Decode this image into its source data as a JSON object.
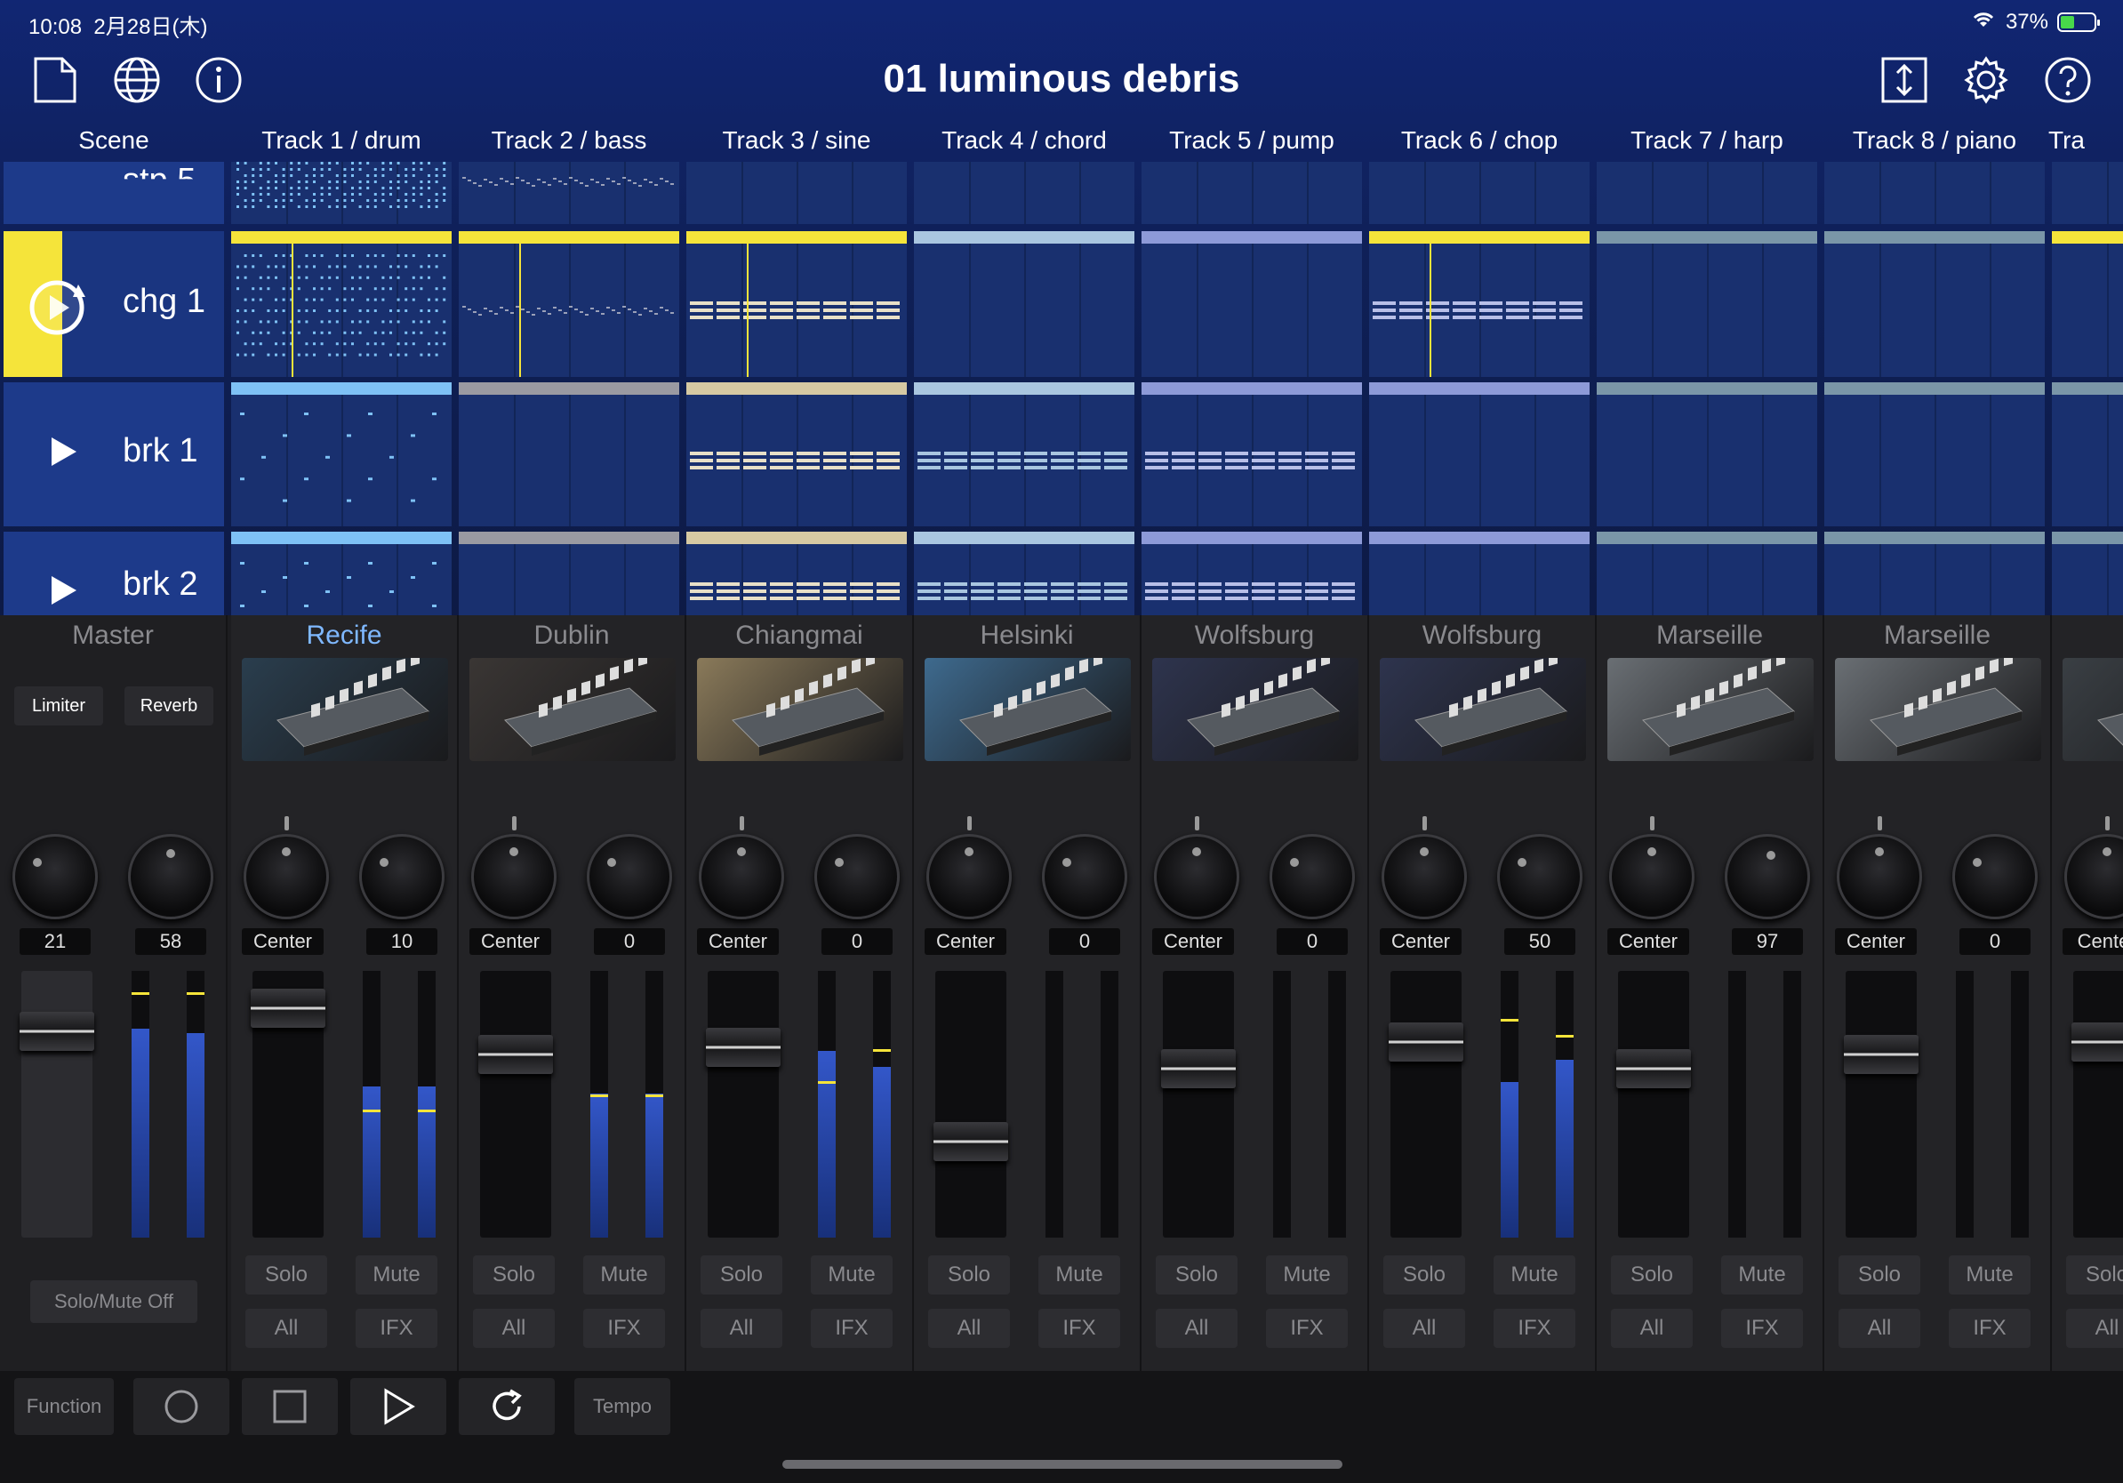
{
  "status": {
    "time": "10:08",
    "date": "2月28日(木)",
    "battery": "37%"
  },
  "header": {
    "title": "01 luminous debris"
  },
  "icons": {
    "new_doc": "document-icon",
    "web": "globe-icon",
    "info": "info-icon",
    "resize": "resize-vertical-icon",
    "settings": "gear-icon",
    "help": "help-icon"
  },
  "grid": {
    "scene_header": "Scene",
    "tracks": [
      "Track 1 / drum",
      "Track 2 / bass",
      "Track 3 / sine",
      "Track 4 / chord",
      "Track 5 / pump",
      "Track 6 / chop",
      "Track 7 / harp",
      "Track 8 / piano",
      "Tra"
    ],
    "scenes": [
      {
        "label": "stp 5",
        "partial": true
      },
      {
        "label": "chg 1",
        "playing": true
      },
      {
        "label": "brk 1"
      },
      {
        "label": "brk 2",
        "partial": true
      }
    ]
  },
  "mixer": {
    "master": {
      "name": "Master",
      "limiter": "Limiter",
      "reverb": "Reverb",
      "knob_left": "21",
      "knob_right": "58",
      "solo_mute_off": "Solo/Mute Off"
    },
    "strips": [
      {
        "name": "Recife",
        "pan": "Center",
        "send": "10",
        "active": true
      },
      {
        "name": "Dublin",
        "pan": "Center",
        "send": "0"
      },
      {
        "name": "Chiangmai",
        "pan": "Center",
        "send": "0"
      },
      {
        "name": "Helsinki",
        "pan": "Center",
        "send": "0"
      },
      {
        "name": "Wolfsburg",
        "pan": "Center",
        "send": "0"
      },
      {
        "name": "Wolfsburg",
        "pan": "Center",
        "send": "50"
      },
      {
        "name": "Marseille",
        "pan": "Center",
        "send": "97"
      },
      {
        "name": "Marseille",
        "pan": "Center",
        "send": "0"
      },
      {
        "name": "",
        "pan": "Cente",
        "send": ""
      }
    ],
    "solo": "Solo",
    "mute": "Mute",
    "all": "All",
    "ifx": "IFX",
    "solo_partial": "Solo"
  },
  "transport": {
    "function": "Function",
    "tempo": "Tempo"
  }
}
